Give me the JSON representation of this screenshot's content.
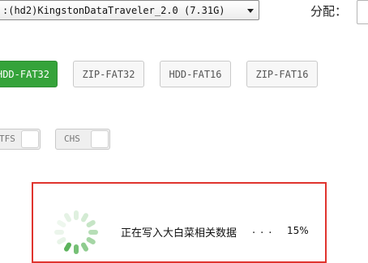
{
  "device": {
    "selected": ":(hd2)KingstonDataTraveler_2.0 (7.31G)"
  },
  "alloc": {
    "label": "分配："
  },
  "modes": [
    {
      "label": "HDD-FAT32",
      "active": true
    },
    {
      "label": "ZIP-FAT32",
      "active": false
    },
    {
      "label": "HDD-FAT16",
      "active": false
    },
    {
      "label": "ZIP-FAT16",
      "active": false
    }
  ],
  "toggles": [
    {
      "label": "TFS"
    },
    {
      "label": "CHS"
    }
  ],
  "progress": {
    "text": "正在写入大白菜相关数据",
    "dots": "...",
    "percent": "15%",
    "value": 0.15
  },
  "colors": {
    "accent": "#35a33a",
    "panel_border": "#e0342e"
  }
}
